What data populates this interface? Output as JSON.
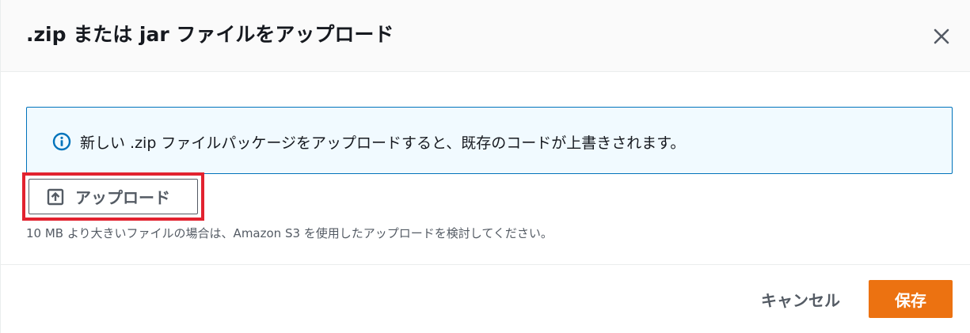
{
  "dialog": {
    "title": ".zip または jar ファイルをアップロード",
    "close_icon": "close-icon"
  },
  "info": {
    "icon": "info-icon",
    "message": "新しい .zip ファイルパッケージをアップロードすると、既存のコードが上書きされます。",
    "accent_color": "#0073bb"
  },
  "upload": {
    "icon": "upload-icon",
    "label": "アップロード",
    "highlight_color": "#e2222f"
  },
  "hint": {
    "text": "10 MB より大きいファイルの場合は、Amazon S3 を使用したアップロードを検討してください。"
  },
  "footer": {
    "cancel_label": "キャンセル",
    "save_label": "保存",
    "save_color": "#ec7211"
  }
}
